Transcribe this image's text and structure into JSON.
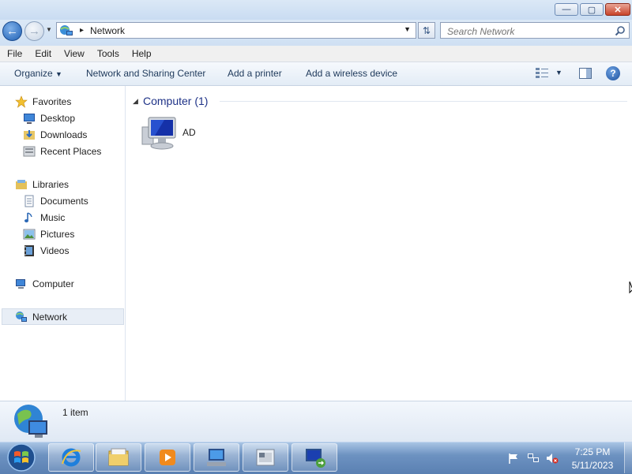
{
  "window": {
    "minimize": "—",
    "maximize": "▢",
    "close": "✕"
  },
  "address": {
    "location": "Network",
    "separator": "▸"
  },
  "search": {
    "placeholder": "Search Network"
  },
  "menu": [
    "File",
    "Edit",
    "View",
    "Tools",
    "Help"
  ],
  "toolbar": {
    "organize": "Organize",
    "network_sharing": "Network and Sharing Center",
    "add_printer": "Add a printer",
    "add_wireless": "Add a wireless device",
    "help": "?"
  },
  "nav": {
    "favorites": "Favorites",
    "desktop": "Desktop",
    "downloads": "Downloads",
    "recent_places": "Recent Places",
    "libraries": "Libraries",
    "documents": "Documents",
    "music": "Music",
    "pictures": "Pictures",
    "videos": "Videos",
    "computer": "Computer",
    "network": "Network"
  },
  "content": {
    "group_title": "Computer (1)",
    "items": [
      {
        "label": "AD",
        "icon": "computer-icon"
      }
    ]
  },
  "details": {
    "count": "1 item"
  },
  "taskbar": {
    "apps": [
      "internet-explorer-icon",
      "windows-explorer-icon",
      "media-player-icon",
      "network-computer-icon",
      "remote-desktop-icon",
      "network-connection-icon"
    ],
    "time": "7:25 PM",
    "date": "5/11/2023"
  },
  "colors": {
    "accent": "#1e3287",
    "taskbar": "#5a80b2",
    "selection": "#e8eef6"
  }
}
